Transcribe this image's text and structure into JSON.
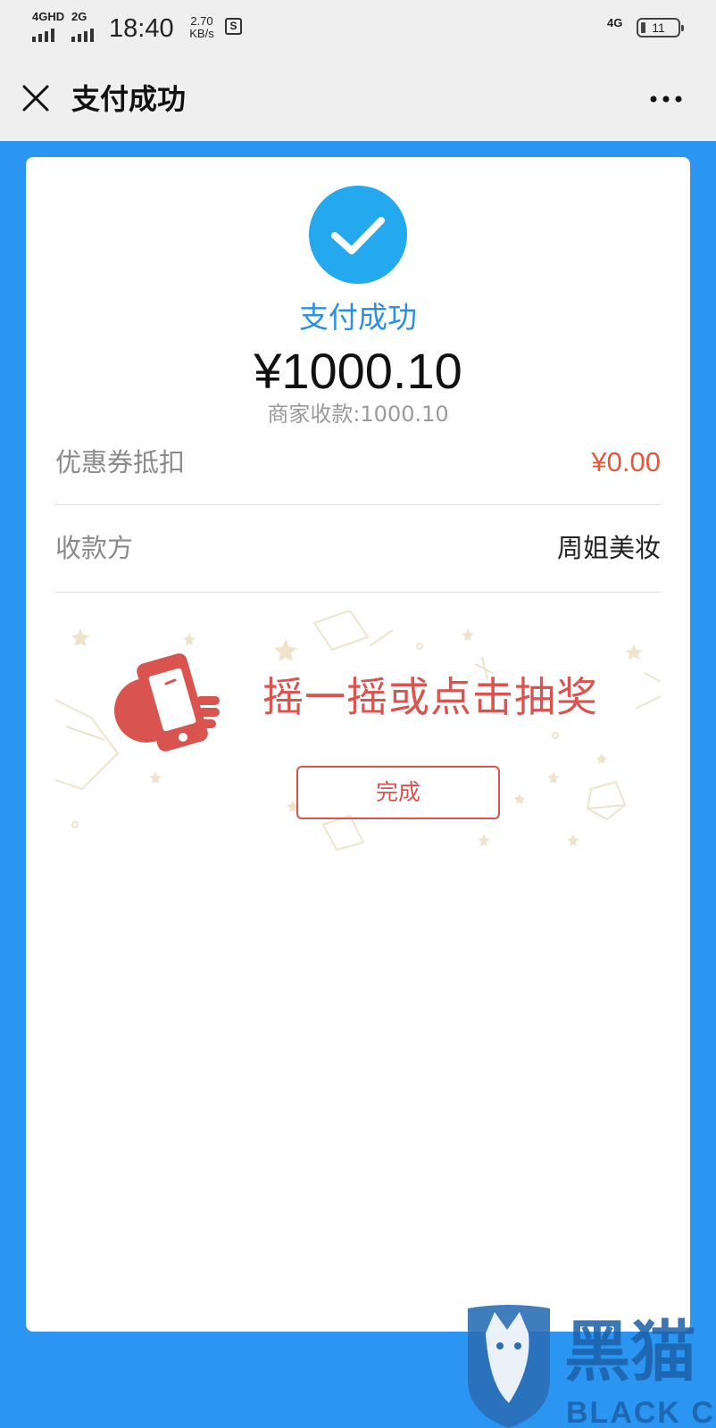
{
  "status_bar": {
    "network1": "4GHD",
    "network2": "2G",
    "time": "18:40",
    "speed_value": "2.70",
    "speed_unit": "KB/s",
    "s_icon": "S",
    "network3": "4G",
    "battery": "11"
  },
  "header": {
    "close_icon": "close-icon",
    "title": "支付成功",
    "more_icon": "more-icon"
  },
  "payment": {
    "status_text": "支付成功",
    "amount": "¥1000.10",
    "merchant_received": "商家收款:1000.10"
  },
  "details": [
    {
      "label": "优惠券抵扣",
      "value": "¥0.00"
    },
    {
      "label": "收款方",
      "value": "周姐美妆"
    }
  ],
  "lottery": {
    "prompt": "摇一摇或点击抽奖",
    "done_label": "完成"
  },
  "watermark": {
    "cn": "黑猫",
    "en": "BLACK CAT"
  },
  "colors": {
    "background_blue": "#2b96f2",
    "check_blue": "#24a8ee",
    "accent_red": "#d9534f",
    "coupon_red": "#e4583a"
  }
}
